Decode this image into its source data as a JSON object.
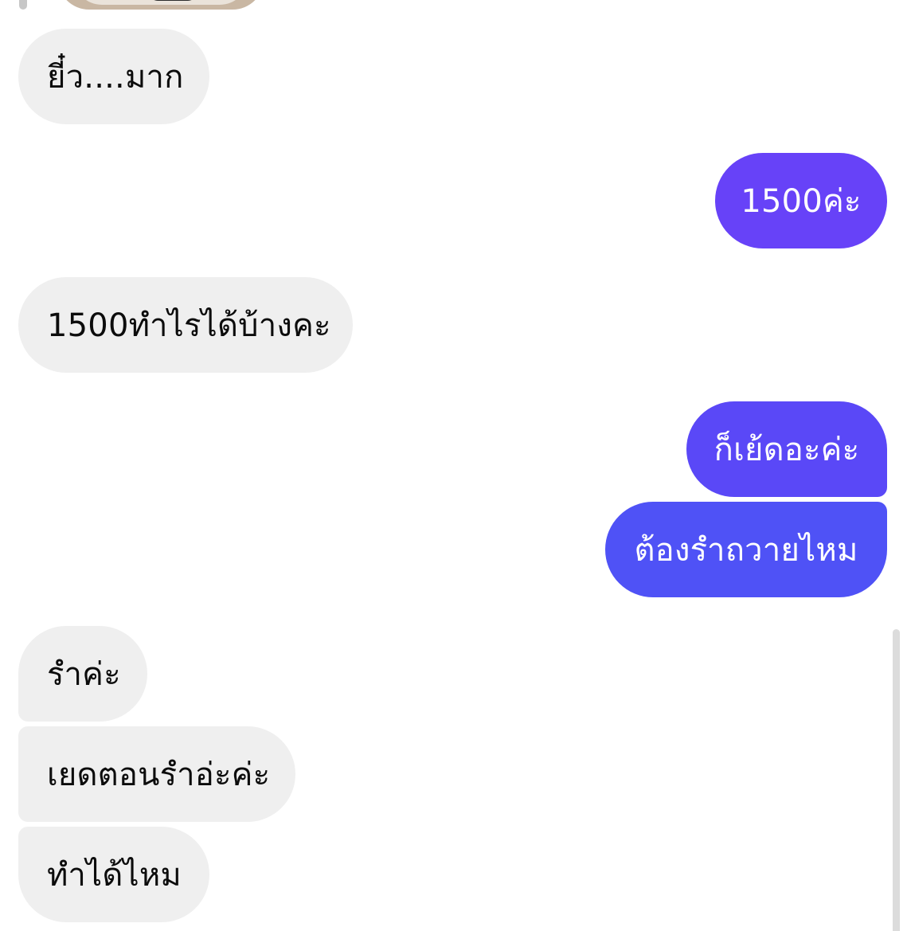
{
  "conversation": {
    "messages": [
      {
        "direction": "incoming",
        "text": "ยี๋ว....มาก"
      },
      {
        "direction": "outgoing",
        "text": "1500ค่ะ"
      },
      {
        "direction": "incoming",
        "text": "1500ทำไรได้บ้างคะ"
      },
      {
        "direction": "outgoing",
        "text": "ก็เย้ดอะค่ะ"
      },
      {
        "direction": "outgoing",
        "text": "ต้องรำถวายไหม"
      },
      {
        "direction": "incoming",
        "text": "รำค่ะ"
      },
      {
        "direction": "incoming",
        "text": "เยดตอนรำอ่ะค่ะ"
      },
      {
        "direction": "incoming",
        "text": "ทำได้ไหม"
      }
    ]
  },
  "colors": {
    "incoming_bubble": "#efefef",
    "outgoing_bubble_gradient": [
      "#6742f8",
      "#5a48f7",
      "#4f52f6"
    ],
    "incoming_text": "#0c0c0c",
    "outgoing_text": "#ffffff"
  }
}
